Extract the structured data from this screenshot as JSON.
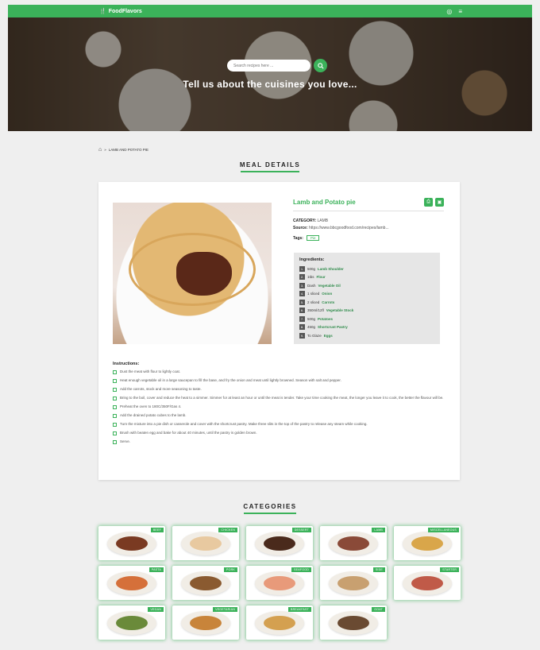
{
  "nav": {
    "brand": "FoodFlavors",
    "brand_icon": "fork-knife-icon",
    "icons": [
      "user-circle-icon",
      "menu-icon"
    ]
  },
  "hero": {
    "search_placeholder": "Search recipes here ...",
    "tagline": "Tell us about the cuisines you love..."
  },
  "breadcrumb": {
    "current": "LAMB AND POTATO PIE"
  },
  "meal_section": {
    "heading": "MEAL DETAILS"
  },
  "meal": {
    "title": "Lamb and Potato pie",
    "category_label": "CATEGORY:",
    "category": "LAMB",
    "source_label": "Source:",
    "source": "https://www.bbcgoodfood.com/recipes/lamb...",
    "tags_label": "Tags:",
    "tag": "Pie",
    "ingredients_title": "Ingredients:",
    "ingredients": [
      {
        "num": "1.",
        "qty": "500g",
        "name": "Lamb Shoulder"
      },
      {
        "num": "2.",
        "qty": "1tbs",
        "name": "Flour"
      },
      {
        "num": "3.",
        "qty": "Dash",
        "name": "Vegetable Oil"
      },
      {
        "num": "4.",
        "qty": "1 sliced",
        "name": "Onion"
      },
      {
        "num": "5.",
        "qty": "2 sliced",
        "name": "Carrots"
      },
      {
        "num": "6.",
        "qty": "350ml/12fl",
        "name": "Vegetable Stock"
      },
      {
        "num": "7.",
        "qty": "500g",
        "name": "Potatoes"
      },
      {
        "num": "8.",
        "qty": "450g",
        "name": "Shortcrust Pastry"
      },
      {
        "num": "9.",
        "qty": "To Glaze",
        "name": "Eggs"
      }
    ],
    "instructions_title": "Instructions:",
    "instructions": [
      "Dust the meat with flour to lightly coat.",
      "Heat enough vegetable oil in a large saucepan to fill the base, and fry the onion and meat until lightly browned. Season with salt and pepper.",
      "Add the carrots, stock and more seasoning to taste.",
      "Bring to the boil, cover and reduce the heat to a simmer. Simmer for at least an hour or until the meat is tender. Take your time cooking the meat, the longer you leave it to cook, the better the flavour will be.",
      "Preheat the oven to 180C/350F/Gas 4.",
      "Add the drained potato cubes to the lamb.",
      "Turn the mixture into a pie dish or casserole and cover with the shortcrust pastry. Make three slits in the top of the pastry to release any steam while cooking.",
      "Brush with beaten egg and bake for about 40 minutes, until the pastry is golden brown.",
      "Serve."
    ]
  },
  "categories_section": {
    "heading": "CATEGORIES",
    "items": [
      {
        "label": "BEEF",
        "color": "#7a3a22"
      },
      {
        "label": "CHICKEN",
        "color": "#e8c9a0"
      },
      {
        "label": "DESSERT",
        "color": "#4a2a1c"
      },
      {
        "label": "LAMB",
        "color": "#8a4a38"
      },
      {
        "label": "MISCELLANEOUS",
        "color": "#d9a64a"
      },
      {
        "label": "PASTA",
        "color": "#d5703a"
      },
      {
        "label": "PORK",
        "color": "#8a5a30"
      },
      {
        "label": "SEAFOOD",
        "color": "#e89a7a"
      },
      {
        "label": "SIDE",
        "color": "#c8a070"
      },
      {
        "label": "STARTER",
        "color": "#c05a48"
      },
      {
        "label": "VEGAN",
        "color": "#6a8a3a"
      },
      {
        "label": "VEGETARIAN",
        "color": "#c8843a"
      },
      {
        "label": "BREAKFAST",
        "color": "#d4a050"
      },
      {
        "label": "GOAT",
        "color": "#6a4a32"
      }
    ]
  }
}
